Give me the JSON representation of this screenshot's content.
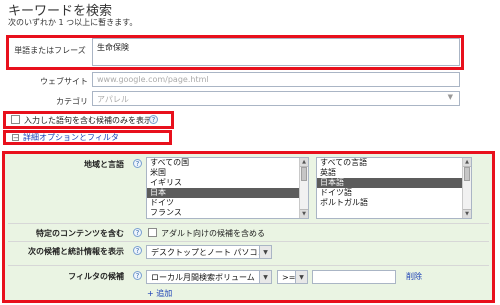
{
  "header": {
    "title": "キーワードを検索",
    "subtitle": "次のいずれか 1 つ以上に暫きます。"
  },
  "form": {
    "phrase_label": "単語またはフレーズ",
    "phrase_value": "生命保険",
    "website_label": "ウェブサイト",
    "website_placeholder": "www.google.com/page.html",
    "category_label": "カテゴリ",
    "category_value": "アパレル"
  },
  "only_entered_label": "入力した語句を含む候補のみを表示",
  "advanced_link": "詳細オプションとフィルタ",
  "advanced": {
    "locale_label": "地域と言語",
    "countries": [
      "すべての国",
      "米国",
      "イギリス",
      "日本",
      "ドイツ",
      "フランス"
    ],
    "countries_selected": "日本",
    "languages": [
      "すべての言語",
      "英語",
      "日本語",
      "ドイツ語",
      "ポルトガル語"
    ],
    "languages_selected": "日本語",
    "content_label": "特定のコンテンツを含む",
    "adult_label": "アダルト向けの候補を含める",
    "stats_label": "次の候補と統計情報を表示",
    "stats_value": "デスクトップとノート パソコン",
    "filter_label": "フィルタの候補",
    "filter_field": "ローカル月間検索ボリューム",
    "filter_op": ">=",
    "filter_value": "",
    "remove_link": "削除",
    "add_link": "+ 追加"
  },
  "colors": {
    "highlight": "#e8101c",
    "panel": "#eaf4e3",
    "link": "#1a3fb5"
  }
}
